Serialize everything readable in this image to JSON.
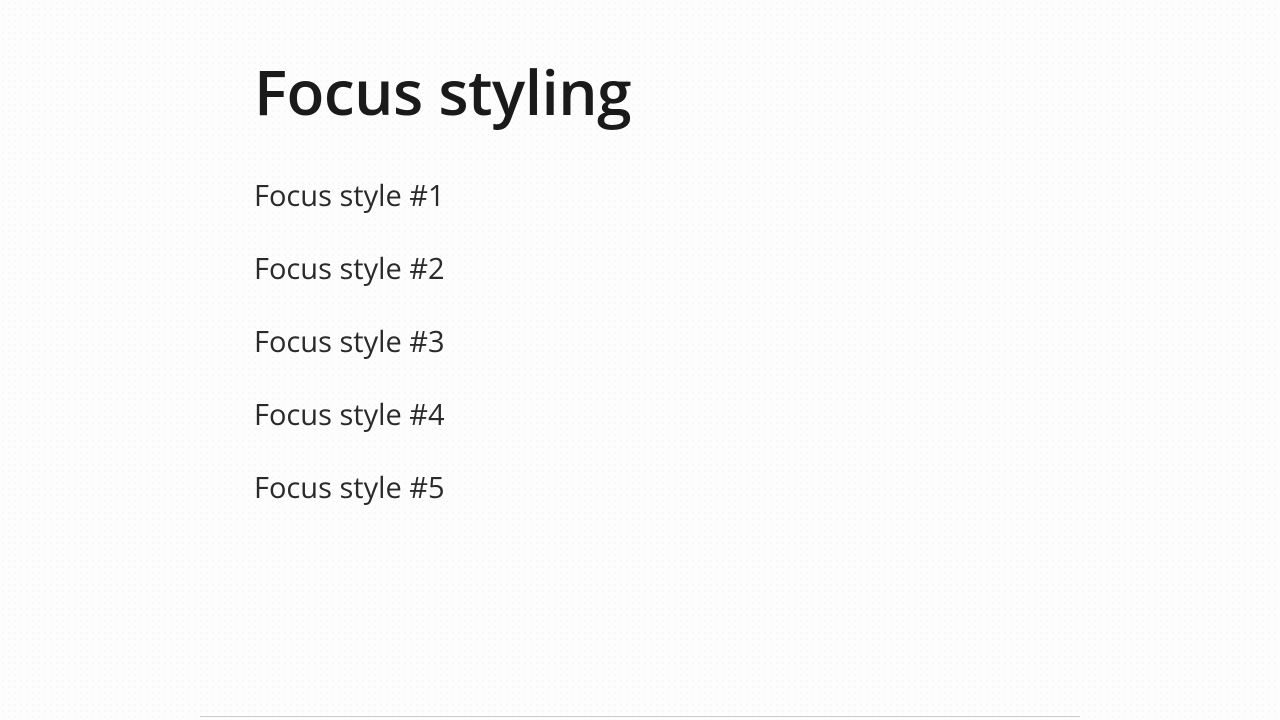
{
  "title": "Focus styling",
  "links": [
    {
      "label": "Focus style #1"
    },
    {
      "label": "Focus style #2"
    },
    {
      "label": "Focus style #3"
    },
    {
      "label": "Focus style #4"
    },
    {
      "label": "Focus style #5"
    }
  ]
}
